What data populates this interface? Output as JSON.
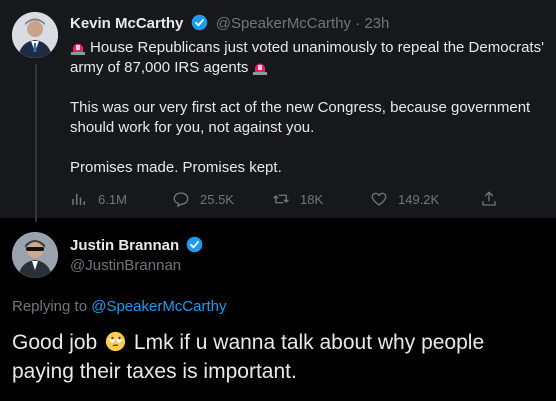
{
  "original_tweet": {
    "author_name": "Kevin McCarthy",
    "author_handle": "@SpeakerMcCarthy",
    "separator": "·",
    "time": "23h",
    "line1": "House Republicans just voted unanimously to repeal the Democrats' army of 87,000 IRS agents",
    "line2": "This was our very first act of the new Congress, because government should work for you, not against you.",
    "line3": "Promises made. Promises kept.",
    "stats": {
      "views": "6.1M",
      "replies": "25.5K",
      "retweets": "18K",
      "likes": "149.2K"
    }
  },
  "reply": {
    "author_name": "Justin Brannan",
    "author_handle": "@JustinBrannan",
    "replying_prefix": "Replying to",
    "replying_handle": "@SpeakerMcCarthy",
    "text_before_emoji": "Good job",
    "text_after_emoji": "Lmk if u wanna talk about why people paying their taxes is important."
  },
  "colors": {
    "background": "#000000",
    "tweet_background": "#16181c",
    "text": "#e7e9ea",
    "muted": "#71767b",
    "accent": "#1d9bf0"
  },
  "icons": [
    "verified-badge-icon",
    "siren-icon",
    "views-icon",
    "reply-icon",
    "retweet-icon",
    "like-icon",
    "share-icon",
    "rolling-eyes-emoji"
  ]
}
